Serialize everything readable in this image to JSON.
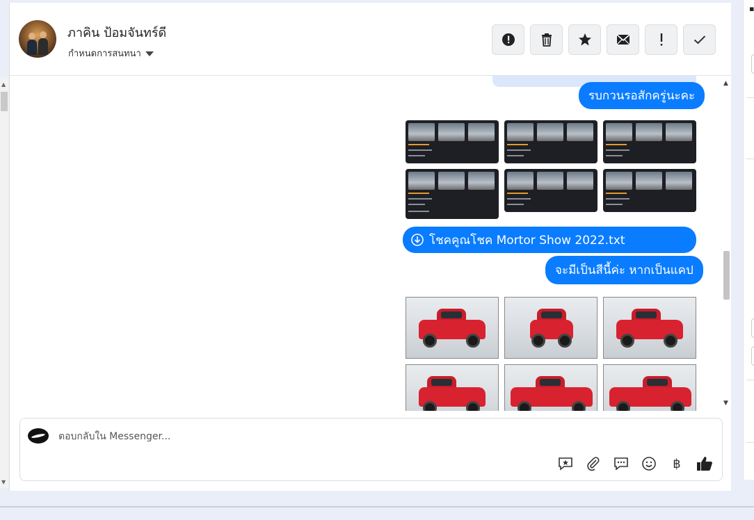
{
  "conversation": {
    "contact_name": "ภาคิน ป้อมจันทร์ดี",
    "assign_label": "กำหนดการสนทนา"
  },
  "actions": [
    {
      "name": "spam-button",
      "icon": "exclamation-circle-icon"
    },
    {
      "name": "delete-button",
      "icon": "trash-icon"
    },
    {
      "name": "star-button",
      "icon": "star-icon"
    },
    {
      "name": "mark-unread-button",
      "icon": "envelope-icon"
    },
    {
      "name": "follow-up-button",
      "icon": "exclamation-icon"
    },
    {
      "name": "done-button",
      "icon": "check-icon"
    }
  ],
  "messages": {
    "msg1": "รบกวนรอสักครู่นะคะ",
    "attachment_file": "โชคคูณโชค Mortor Show 2022.txt",
    "msg2": "จะมีเป็นสีนี้ค่ะ หากเป็นแคป"
  },
  "composer": {
    "placeholder": "ตอบกลับใน Messenger...",
    "currency_symbol": "฿"
  },
  "colors": {
    "bubble": "#0a7cff",
    "car": "#d8222f"
  }
}
